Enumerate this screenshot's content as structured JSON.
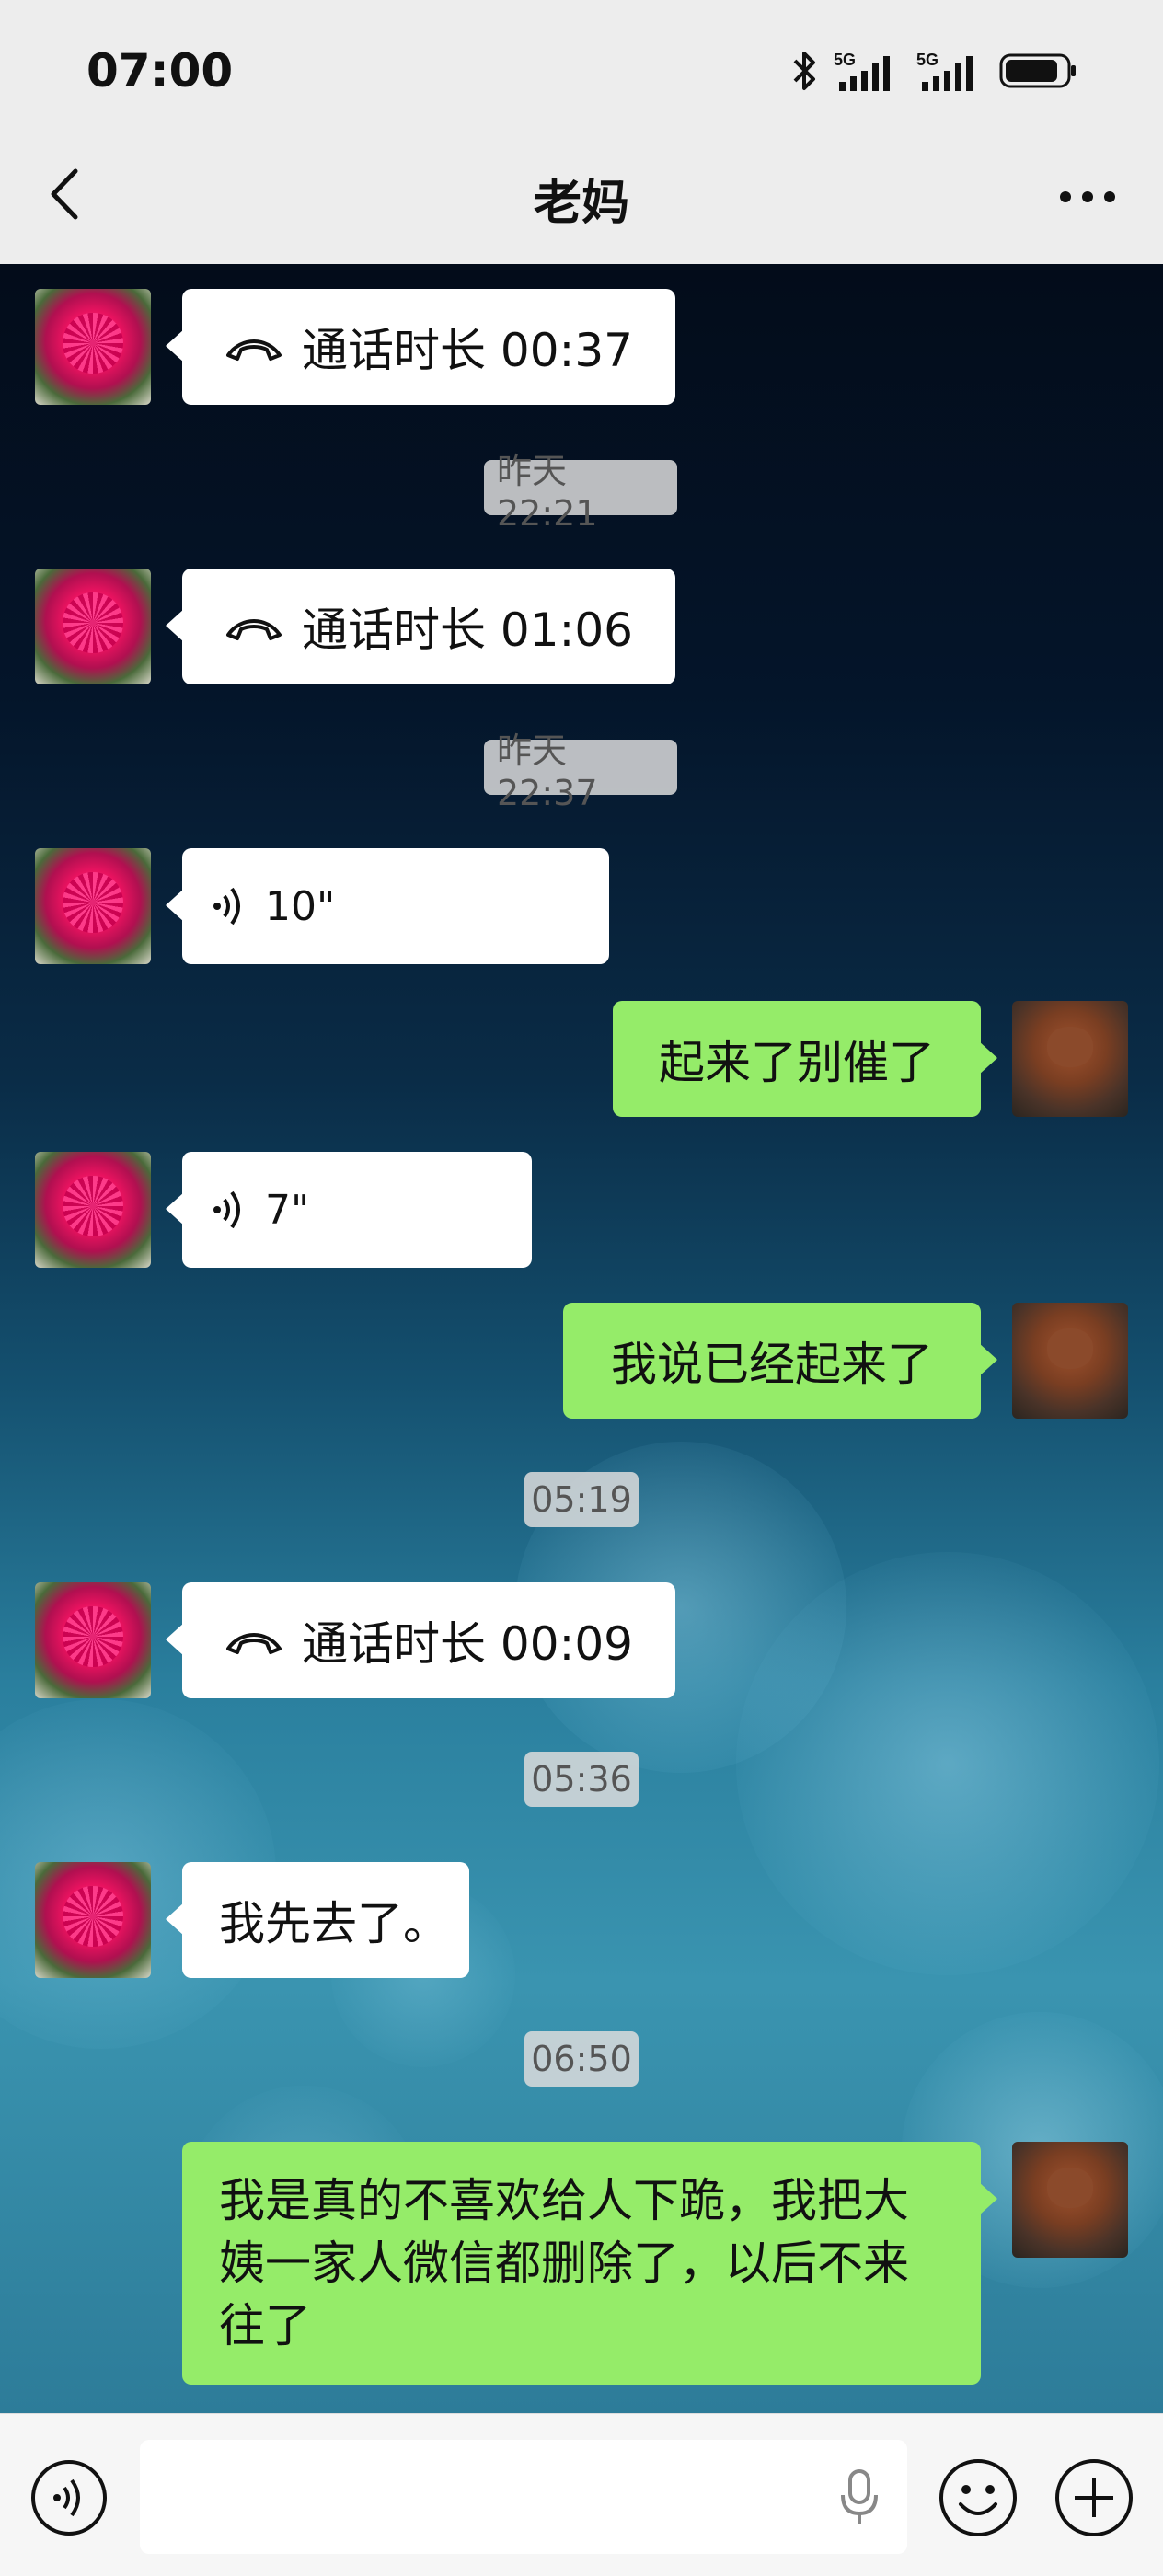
{
  "status": {
    "time": "07:00",
    "signal1": "5G",
    "signal2": "5G"
  },
  "nav": {
    "title": "老妈",
    "back_icon": "chevron-left-icon",
    "more_icon": "more-dots-icon"
  },
  "messages": [
    {
      "side": "left",
      "type": "call",
      "text": "通话时长 00:37"
    },
    {
      "type": "time",
      "text": "昨天 22:21"
    },
    {
      "side": "left",
      "type": "call",
      "text": "通话时长 01:06"
    },
    {
      "type": "time",
      "text": "昨天 22:37"
    },
    {
      "side": "left",
      "type": "voice",
      "text": "10\""
    },
    {
      "side": "right",
      "type": "text",
      "text": "起来了别催了"
    },
    {
      "side": "left",
      "type": "voice",
      "text": "7\""
    },
    {
      "side": "right",
      "type": "text",
      "text": "我说已经起来了"
    },
    {
      "type": "time",
      "text": "05:19"
    },
    {
      "side": "left",
      "type": "call",
      "text": "通话时长 00:09"
    },
    {
      "type": "time",
      "text": "05:36"
    },
    {
      "side": "left",
      "type": "text",
      "text": "我先去了。"
    },
    {
      "type": "time",
      "text": "06:50"
    },
    {
      "side": "right",
      "type": "text",
      "text": "我是真的不喜欢给人下跪，我把大姨一家人微信都删除了，以后不来往了"
    }
  ],
  "colors": {
    "bubble_self": "#95ec69",
    "bubble_other": "#ffffff",
    "topbar": "#ededed"
  }
}
